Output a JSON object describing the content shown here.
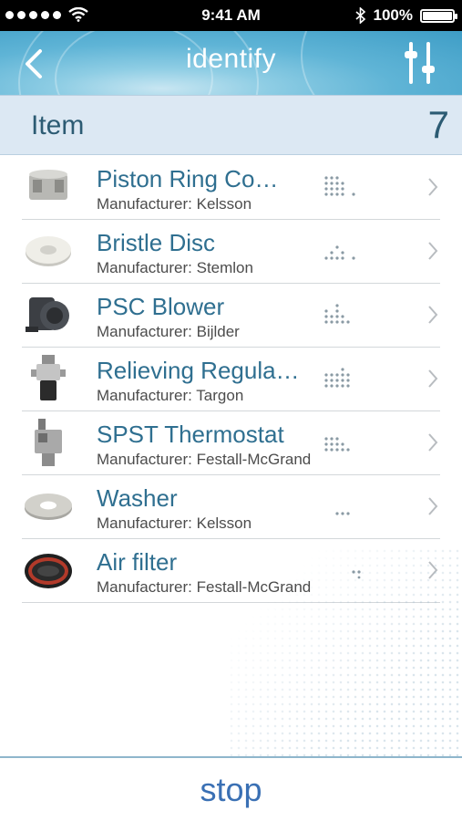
{
  "status_bar": {
    "time": "9:41 AM",
    "battery": "100%"
  },
  "nav": {
    "title": "identify",
    "back_icon": "chevron-left-icon",
    "settings_icon": "sliders-icon"
  },
  "section": {
    "title": "Item",
    "count": "7"
  },
  "items": [
    {
      "name": "Piston Ring Co…",
      "manufacturer": "Manufacturer: Kelsson",
      "thumb": "piston-ring-image"
    },
    {
      "name": "Bristle Disc",
      "manufacturer": "Manufacturer: Stemlon",
      "thumb": "bristle-disc-image"
    },
    {
      "name": "PSC Blower",
      "manufacturer": "Manufacturer: Bijlder",
      "thumb": "psc-blower-image"
    },
    {
      "name": "Relieving Regula…",
      "manufacturer": "Manufacturer: Targon",
      "thumb": "regulator-image"
    },
    {
      "name": "SPST Thermostat",
      "manufacturer": "Manufacturer: Festall-McGrand",
      "thumb": "thermostat-image"
    },
    {
      "name": "Washer",
      "manufacturer": "Manufacturer: Kelsson",
      "thumb": "washer-image"
    },
    {
      "name": "Air filter",
      "manufacturer": "Manufacturer: Festall-McGrand",
      "thumb": "air-filter-image"
    }
  ],
  "toolbar": {
    "stop_label": "stop"
  },
  "colors": {
    "accent": "#3a70b4",
    "item_title": "#2f6f90",
    "header_bg": "#dce8f3"
  }
}
